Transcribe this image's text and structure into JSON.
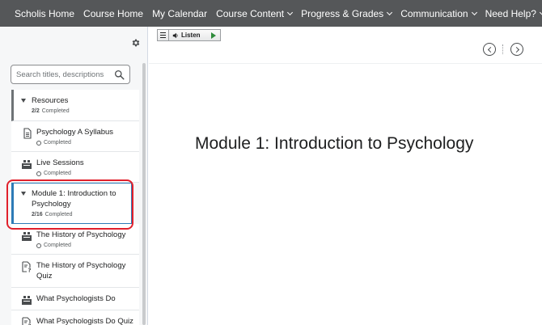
{
  "nav": {
    "items": [
      {
        "label": "Scholis Home",
        "dropdown": false
      },
      {
        "label": "Course Home",
        "dropdown": false
      },
      {
        "label": "My Calendar",
        "dropdown": false
      },
      {
        "label": "Course Content",
        "dropdown": true
      },
      {
        "label": "Progress & Grades",
        "dropdown": true
      },
      {
        "label": "Communication",
        "dropdown": true
      },
      {
        "label": "Need Help?",
        "dropdown": true
      }
    ]
  },
  "sidebar": {
    "settings_icon": "gear-icon",
    "search": {
      "placeholder": "Search titles, descriptions",
      "value": ""
    },
    "toc": [
      {
        "type": "module",
        "title": "Resources",
        "progress_count": "2/2",
        "progress_label": "Completed"
      },
      {
        "type": "topic",
        "icon": "document-icon",
        "title": "Psychology A Syllabus",
        "status": "Completed"
      },
      {
        "type": "topic",
        "icon": "live-session-icon",
        "title": "Live Sessions",
        "status": "Completed"
      },
      {
        "type": "module",
        "selected": true,
        "title": "Module 1: Introduction to Psychology",
        "progress_count": "2/16",
        "progress_label": "Completed"
      },
      {
        "type": "topic",
        "icon": "live-session-icon",
        "title": "The History of Psychology",
        "status": "Completed"
      },
      {
        "type": "topic",
        "icon": "quiz-icon",
        "title": "The History of Psychology Quiz",
        "status": ""
      },
      {
        "type": "topic",
        "icon": "live-session-icon",
        "title": "What Psychologists Do",
        "status": ""
      },
      {
        "type": "topic",
        "icon": "quiz-icon",
        "title": "What Psychologists Do Quiz",
        "status": ""
      }
    ]
  },
  "main": {
    "listen": {
      "label": "Listen"
    },
    "heading": "Module 1: Introduction to Psychology"
  },
  "colors": {
    "nav_bg": "#555759",
    "selection_border": "#2d7bb7",
    "annotation_ring": "#e0202c"
  }
}
